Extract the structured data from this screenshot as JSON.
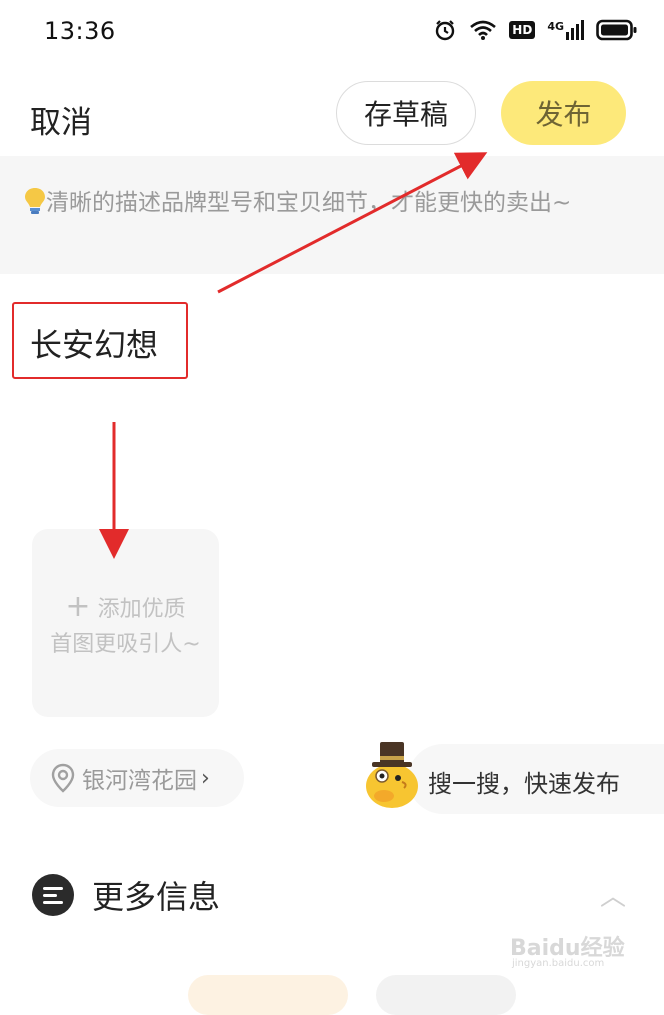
{
  "status_bar": {
    "time": "13:36",
    "hd": "HD",
    "network": "4G"
  },
  "header": {
    "cancel": "取消",
    "save_draft": "存草稿",
    "publish": "发布"
  },
  "tip": {
    "icon": "lightbulb-icon",
    "text": "清晰的描述品牌型号和宝贝细节，才能更快的卖出~"
  },
  "title_input": {
    "value": "长安幻想"
  },
  "add_image": {
    "plus": "+",
    "line1": "添加优质",
    "line2": "首图更吸引人~"
  },
  "location": {
    "text": "银河湾花园"
  },
  "quick_search": {
    "text": "搜一搜，快速发布"
  },
  "more_info": {
    "title": "更多信息"
  },
  "watermark": {
    "brand": "Baidu经验",
    "url": "jingyan.baidu.com"
  },
  "colors": {
    "publish_bg": "#fde97a",
    "annotation_red": "#e22b2b",
    "tip_bg": "#f6f6f6"
  }
}
